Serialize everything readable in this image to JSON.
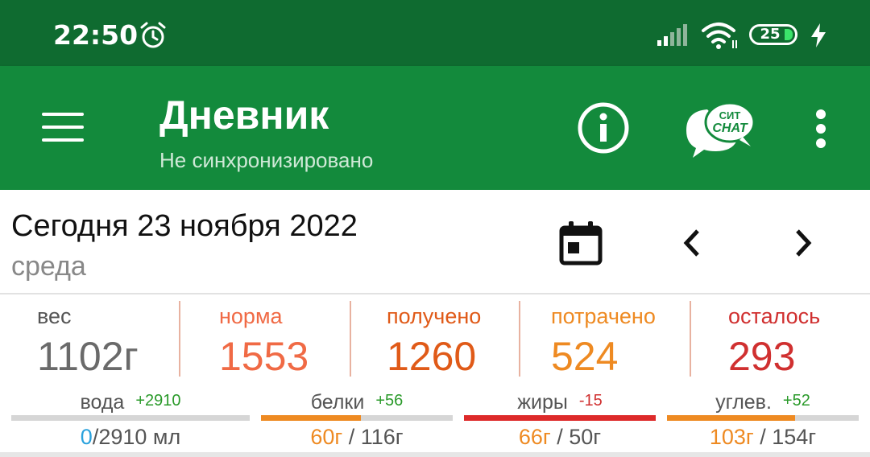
{
  "status_bar": {
    "time": "22:50",
    "battery_level": "25"
  },
  "app_bar": {
    "title": "Дневник",
    "subtitle": "Не синхронизировано",
    "chat_top": "СИТ",
    "chat_bottom": "CHAT"
  },
  "date_row": {
    "date": "Сегодня 23 ноября 2022",
    "weekday": "среда"
  },
  "stats": [
    {
      "label": "вес",
      "value": "1102г",
      "label_color": "#555555",
      "value_color": "#6a6a6a"
    },
    {
      "label": "норма",
      "value": "1553",
      "label_color": "#f06a45",
      "value_color": "#f06a45"
    },
    {
      "label": "получено",
      "value": "1260",
      "label_color": "#e05a18",
      "value_color": "#e05a18"
    },
    {
      "label": "потрачено",
      "value": "524",
      "label_color": "#ee8a22",
      "value_color": "#ee8a22"
    },
    {
      "label": "осталось",
      "value": "293",
      "label_color": "#d03030",
      "value_color": "#d03030"
    }
  ],
  "macros": [
    {
      "name": "вода",
      "delta": "+2910",
      "delta_color": "#2a9a2a",
      "current": "0",
      "total": "/2910 мл",
      "current_color": "#2aa2dd",
      "progress": 0.0,
      "bar_color": "#2aa2dd"
    },
    {
      "name": "белки",
      "delta": "+56",
      "delta_color": "#2a9a2a",
      "current": "60г",
      "total": " / 116г",
      "current_color": "#ee8a22",
      "progress": 0.52,
      "bar_color": "#ee8a22"
    },
    {
      "name": "жиры",
      "delta": "-15",
      "delta_color": "#d03030",
      "current": "66г",
      "total": " / 50г",
      "current_color": "#ee8a22",
      "progress": 1.0,
      "bar_color": "#dd2a2a"
    },
    {
      "name": "углев.",
      "delta": "+52",
      "delta_color": "#2a9a2a",
      "current": "103г",
      "total": " / 154г",
      "current_color": "#ee8a22",
      "progress": 0.67,
      "bar_color": "#ee8a22"
    }
  ]
}
